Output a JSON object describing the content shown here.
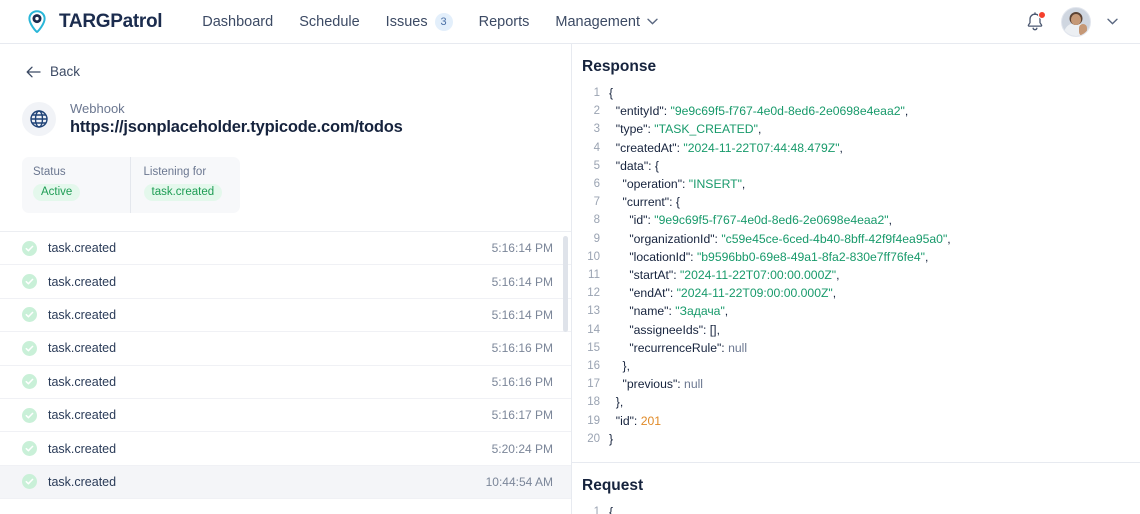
{
  "nav": {
    "brand": "TARGPatrol",
    "logo_icon": "map-pin-icon",
    "links": [
      {
        "label": "Dashboard",
        "badge": null,
        "caret": false
      },
      {
        "label": "Schedule",
        "badge": null,
        "caret": false
      },
      {
        "label": "Issues",
        "badge": "3",
        "caret": false
      },
      {
        "label": "Reports",
        "badge": null,
        "caret": false
      },
      {
        "label": "Management",
        "badge": null,
        "caret": true
      }
    ],
    "bell_icon": "notification-bell-icon",
    "avatar_icon": "user-avatar",
    "account_caret_icon": "chevron-down-icon"
  },
  "left": {
    "back_label": "Back",
    "back_icon": "arrow-left-icon",
    "globe_icon": "globe-icon",
    "hook_kind": "Webhook",
    "hook_url": "https://jsonplaceholder.typicode.com/todos",
    "meta": [
      {
        "label": "Status",
        "value": "Active"
      },
      {
        "label": "Listening for",
        "value": "task.created"
      }
    ],
    "events": [
      {
        "name": "task.created",
        "time": "10:44:54 AM",
        "selected": true
      },
      {
        "name": "task.created",
        "time": "5:20:24 PM",
        "selected": false
      },
      {
        "name": "task.created",
        "time": "5:16:17 PM",
        "selected": false
      },
      {
        "name": "task.created",
        "time": "5:16:16 PM",
        "selected": false
      },
      {
        "name": "task.created",
        "time": "5:16:16 PM",
        "selected": false
      },
      {
        "name": "task.created",
        "time": "5:16:14 PM",
        "selected": false
      },
      {
        "name": "task.created",
        "time": "5:16:14 PM",
        "selected": false
      },
      {
        "name": "task.created",
        "time": "5:16:14 PM",
        "selected": false
      }
    ]
  },
  "right": {
    "response_title": "Response",
    "request_title": "Request",
    "response_lines": [
      {
        "n": "1",
        "indent": 0,
        "parts": [
          {
            "t": "{",
            "c": "p"
          }
        ]
      },
      {
        "n": "2",
        "indent": 1,
        "parts": [
          {
            "t": "\"entityId\": ",
            "c": "k"
          },
          {
            "t": "\"9e9c69f5-f767-4e0d-8ed6-2e0698e4eaa2\"",
            "c": "s"
          },
          {
            "t": ",",
            "c": "p"
          }
        ]
      },
      {
        "n": "3",
        "indent": 1,
        "parts": [
          {
            "t": "\"type\": ",
            "c": "k"
          },
          {
            "t": "\"TASK_CREATED\"",
            "c": "s"
          },
          {
            "t": ",",
            "c": "p"
          }
        ]
      },
      {
        "n": "4",
        "indent": 1,
        "parts": [
          {
            "t": "\"createdAt\": ",
            "c": "k"
          },
          {
            "t": "\"2024-11-22T07:44:48.479Z\"",
            "c": "s"
          },
          {
            "t": ",",
            "c": "p"
          }
        ]
      },
      {
        "n": "5",
        "indent": 1,
        "parts": [
          {
            "t": "\"data\": {",
            "c": "k"
          }
        ]
      },
      {
        "n": "6",
        "indent": 2,
        "parts": [
          {
            "t": "\"operation\": ",
            "c": "k"
          },
          {
            "t": "\"INSERT\"",
            "c": "s"
          },
          {
            "t": ",",
            "c": "p"
          }
        ]
      },
      {
        "n": "7",
        "indent": 2,
        "parts": [
          {
            "t": "\"current\": {",
            "c": "k"
          }
        ]
      },
      {
        "n": "8",
        "indent": 3,
        "parts": [
          {
            "t": "\"id\": ",
            "c": "k"
          },
          {
            "t": "\"9e9c69f5-f767-4e0d-8ed6-2e0698e4eaa2\"",
            "c": "s"
          },
          {
            "t": ",",
            "c": "p"
          }
        ]
      },
      {
        "n": "9",
        "indent": 3,
        "parts": [
          {
            "t": "\"organizationId\": ",
            "c": "k"
          },
          {
            "t": "\"c59e45ce-6ced-4b40-8bff-42f9f4ea95a0\"",
            "c": "s"
          },
          {
            "t": ",",
            "c": "p"
          }
        ]
      },
      {
        "n": "10",
        "indent": 3,
        "parts": [
          {
            "t": "\"locationId\": ",
            "c": "k"
          },
          {
            "t": "\"b9596bb0-69e8-49a1-8fa2-830e7ff76fe4\"",
            "c": "s"
          },
          {
            "t": ",",
            "c": "p"
          }
        ]
      },
      {
        "n": "11",
        "indent": 3,
        "parts": [
          {
            "t": "\"startAt\": ",
            "c": "k"
          },
          {
            "t": "\"2024-11-22T07:00:00.000Z\"",
            "c": "s"
          },
          {
            "t": ",",
            "c": "p"
          }
        ]
      },
      {
        "n": "12",
        "indent": 3,
        "parts": [
          {
            "t": "\"endAt\": ",
            "c": "k"
          },
          {
            "t": "\"2024-11-22T09:00:00.000Z\"",
            "c": "s"
          },
          {
            "t": ",",
            "c": "p"
          }
        ]
      },
      {
        "n": "13",
        "indent": 3,
        "parts": [
          {
            "t": "\"name\": ",
            "c": "k"
          },
          {
            "t": "\"Задача\"",
            "c": "s"
          },
          {
            "t": ",",
            "c": "p"
          }
        ]
      },
      {
        "n": "14",
        "indent": 3,
        "parts": [
          {
            "t": "\"assigneeIds\": [],",
            "c": "k"
          }
        ]
      },
      {
        "n": "15",
        "indent": 3,
        "parts": [
          {
            "t": "\"recurrenceRule\": ",
            "c": "k"
          },
          {
            "t": "null",
            "c": "nl"
          }
        ]
      },
      {
        "n": "16",
        "indent": 2,
        "parts": [
          {
            "t": "},",
            "c": "p"
          }
        ]
      },
      {
        "n": "17",
        "indent": 2,
        "parts": [
          {
            "t": "\"previous\": ",
            "c": "k"
          },
          {
            "t": "null",
            "c": "nl"
          }
        ]
      },
      {
        "n": "18",
        "indent": 1,
        "parts": [
          {
            "t": "},",
            "c": "p"
          }
        ]
      },
      {
        "n": "19",
        "indent": 1,
        "parts": [
          {
            "t": "\"id\": ",
            "c": "k"
          },
          {
            "t": "201",
            "c": "n"
          }
        ]
      },
      {
        "n": "20",
        "indent": 0,
        "parts": [
          {
            "t": "}",
            "c": "p"
          }
        ]
      }
    ],
    "request_lines": [
      {
        "n": "1",
        "indent": 0,
        "parts": [
          {
            "t": "{",
            "c": "p"
          }
        ]
      }
    ]
  },
  "colors": {
    "brand_logo": "#29b6d8",
    "accent_green": "#189a6b",
    "pill_green_bg": "#e4f8ec",
    "pill_green_text": "#1f9d55",
    "number_orange": "#e08a28",
    "badge_blue_bg": "#e3effb",
    "alert_red": "#f5402c",
    "text_dark": "#16233d"
  }
}
